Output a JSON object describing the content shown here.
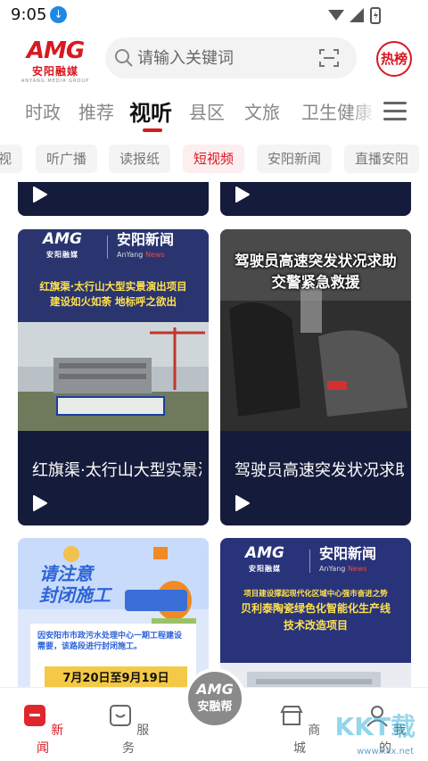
{
  "status": {
    "time": "9:05"
  },
  "header": {
    "logo_mark": "AMG",
    "logo_cn": "安阳融媒",
    "logo_en": "ANYANG MEDIA GROUP",
    "search_placeholder": "请输入关键词",
    "hot_label": "热榜"
  },
  "tabs": [
    {
      "label": "时政"
    },
    {
      "label": "推荐"
    },
    {
      "label": "视听",
      "active": true
    },
    {
      "label": "县区"
    },
    {
      "label": "文旅"
    },
    {
      "label": "卫生健康"
    }
  ],
  "chips": [
    {
      "label": "视"
    },
    {
      "label": "听广播"
    },
    {
      "label": "读报纸"
    },
    {
      "label": "短视频",
      "active": true
    },
    {
      "label": "安阳新闻"
    },
    {
      "label": "直播安阳"
    }
  ],
  "cards": {
    "c1": {
      "brand": "AMG",
      "brand_sub": "安阳融媒",
      "news": "安阳新闻",
      "news_en": "AnYang",
      "news_en2": "News",
      "headline_l1": "红旗渠·太行山大型实景演出项目",
      "headline_l2": "建设如火如荼 地标呼之欲出",
      "title": "红旗渠·太行山大型实景演出项目建设如火如荼"
    },
    "c2": {
      "headline_l1": "驾驶员高速突发状况求助",
      "headline_l2": "交警紧急救援",
      "title": "驾驶员高速突发状况求助"
    },
    "c3": {
      "sign_l1": "请注意",
      "sign_l2": "封闭施工",
      "notice": "因安阳市市政污水处理中心一期工程建设需要，该路段进行封闭施工。",
      "dates": "7月20日至9月19日"
    },
    "c4": {
      "brand": "AMG",
      "brand_sub": "安阳融媒",
      "news": "安阳新闻",
      "news_en": "AnYang",
      "news_en2": "News",
      "h1": "项目建设撑起现代化区域中心强市奋进之势",
      "h2": "贝利泰陶瓷绿色化智能化生产线",
      "h3": "技术改造项目"
    }
  },
  "bottom_nav": [
    {
      "label": "新闻",
      "active": true
    },
    {
      "label": "服务"
    },
    {
      "label": "商城"
    },
    {
      "label": "我的"
    }
  ],
  "center_button": {
    "mark": "AMG",
    "label": "安融帮"
  },
  "watermark": {
    "text": "KKT载",
    "url": "www.kkx.net"
  }
}
